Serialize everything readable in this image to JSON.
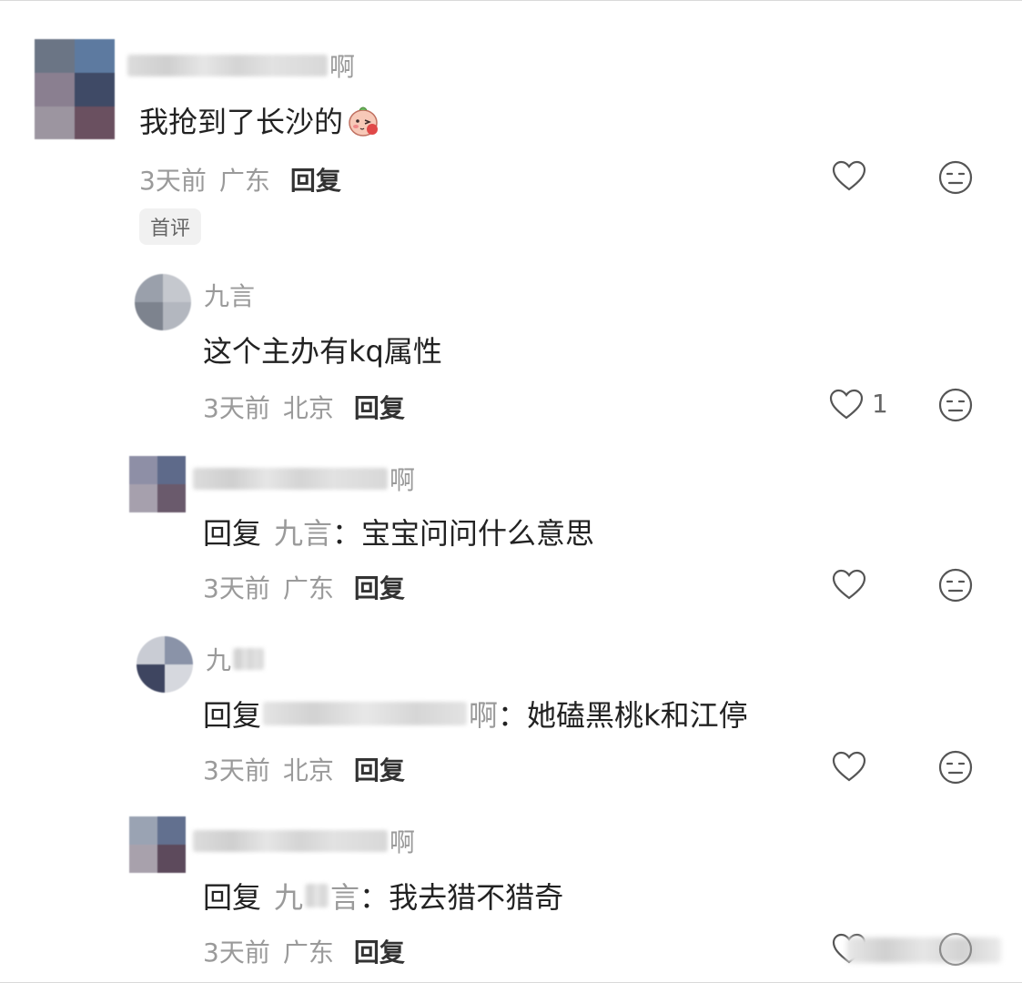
{
  "comments": [
    {
      "name_tail": "啊",
      "text": "我抢到了长沙的",
      "emoji": "blush-emoji-icon",
      "time": "3天前",
      "location": "广东",
      "reply_label": "回复",
      "badge": "首评",
      "like_count": ""
    },
    {
      "name_tail": "九言",
      "text": "这个主办有kq属性",
      "time": "3天前",
      "location": "北京",
      "reply_label": "回复",
      "like_count": "1"
    },
    {
      "name_tail": "啊",
      "reply_prefix": "回复",
      "reply_target": "九言",
      "reply_colon": "：",
      "text": "宝宝问问什么意思",
      "time": "3天前",
      "location": "广东",
      "reply_label": "回复",
      "like_count": ""
    },
    {
      "name_tail": "九",
      "reply_prefix": "回复",
      "reply_target_tail": "啊",
      "reply_colon": "：",
      "text": "她磕黑桃k和江停",
      "time": "3天前",
      "location": "北京",
      "reply_label": "回复",
      "like_count": ""
    },
    {
      "name_tail": "啊",
      "reply_prefix": "回复",
      "reply_target_head": "九",
      "reply_target_tail": "言",
      "reply_colon": "：",
      "text": "我去猎不猎奇",
      "time": "3天前",
      "location": "广东",
      "reply_label": "回复",
      "like_count": ""
    }
  ],
  "colors": {
    "text_primary": "#222222",
    "text_secondary": "#9a9a9a",
    "background": "#ffffff",
    "badge_bg": "#f1f1f1"
  }
}
